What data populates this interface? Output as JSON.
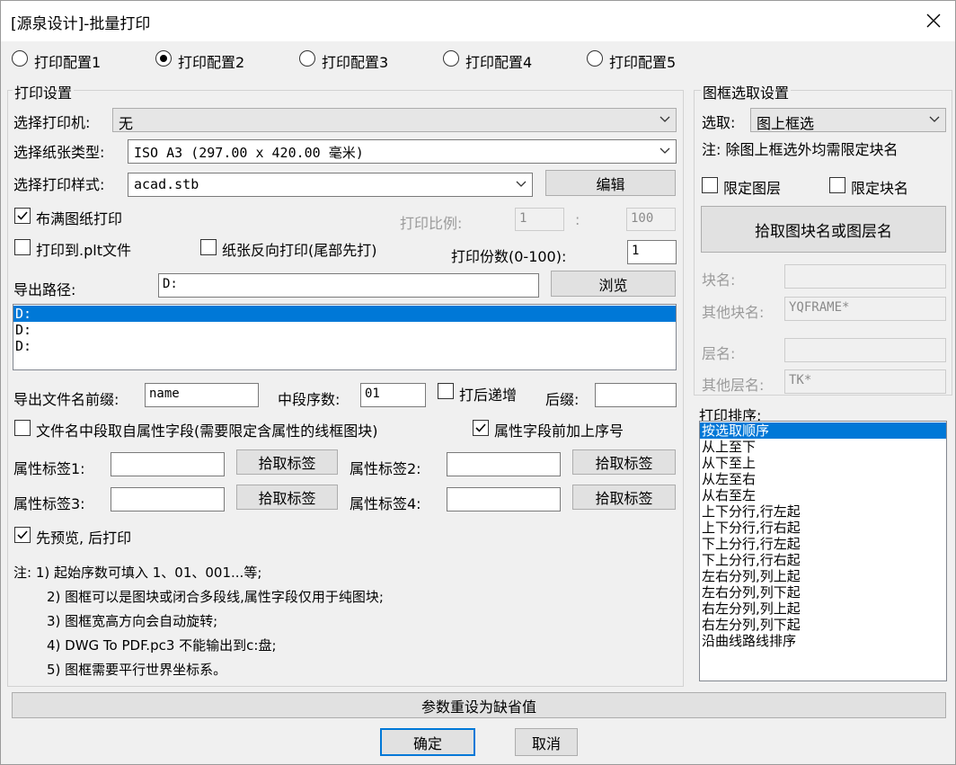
{
  "title": "[源泉设计]-批量打印",
  "config_tabs": [
    "打印配置1",
    "打印配置2",
    "打印配置3",
    "打印配置4",
    "打印配置5"
  ],
  "print_settings": {
    "group_label": "打印设置",
    "printer_label": "选择打印机:",
    "printer_value": "无",
    "paper_label": "选择纸张类型:",
    "paper_value": "ISO A3 (297.00 x 420.00 毫米)",
    "style_label": "选择打印样式:",
    "style_value": "acad.stb",
    "edit_button": "编辑",
    "fill_paper_label": "布满图纸打印",
    "scale_label": "打印比例:",
    "scale_left": "1",
    "scale_sep": ":",
    "scale_right": "100",
    "plot_file_label": "打印到.plt文件",
    "reverse_label": "纸张反向打印(尾部先打)",
    "copies_label": "打印份数(0-100):",
    "copies_value": "1",
    "export_path_label": "导出路径:",
    "export_path_value": "D:",
    "browse_button": "浏览",
    "path_list": [
      "D:",
      "D:",
      "D:"
    ],
    "prefix_label": "导出文件名前缀:",
    "prefix_value": "name",
    "mid_seq_label": "中段序数:",
    "mid_seq_value": "01",
    "increment_label": "打后递增",
    "suffix_label": "后缀:",
    "suffix_value": "",
    "attr_mid_label": "文件名中段取自属性字段(需要限定含属性的线框图块)",
    "attr_seq_label": "属性字段前加上序号",
    "attr_tags": [
      {
        "label": "属性标签1:",
        "value": "",
        "button": "拾取标签"
      },
      {
        "label": "属性标签2:",
        "value": "",
        "button": "拾取标签"
      },
      {
        "label": "属性标签3:",
        "value": "",
        "button": "拾取标签"
      },
      {
        "label": "属性标签4:",
        "value": "",
        "button": "拾取标签"
      }
    ],
    "preview_label": "先预览, 后打印",
    "notes": [
      "注: 1) 起始序数可填入 1、01、001...等;",
      "2) 图框可以是图块或闭合多段线,属性字段仅用于纯图块;",
      "3) 图框宽高方向会自动旋转;",
      "4) DWG To PDF.pc3 不能输出到c:盘;",
      "5) 图框需要平行世界坐标系。"
    ]
  },
  "frame_select": {
    "group_label": "图框选取设置",
    "select_label": "选取:",
    "select_value": "图上框选",
    "note": "注: 除图上框选外均需限定块名",
    "limit_layer_label": "限定图层",
    "limit_block_label": "限定块名",
    "pick_button": "拾取图块名或图层名",
    "block_name_label": "块名:",
    "block_name_value": "",
    "other_block_label": "其他块名:",
    "other_block_value": "YQFRAME*",
    "layer_name_label": "层名:",
    "layer_name_value": "",
    "other_layer_label": "其他层名:",
    "other_layer_value": "TK*"
  },
  "sort": {
    "label": "打印排序:",
    "items": [
      "按选取顺序",
      "从上至下",
      "从下至上",
      "从左至右",
      "从右至左",
      "上下分行,行左起",
      "上下分行,行右起",
      "下上分行,行左起",
      "下上分行,行右起",
      "左右分列,列上起",
      "左右分列,列下起",
      "右左分列,列上起",
      "右左分列,列下起",
      "沿曲线路线排序"
    ]
  },
  "reset_button": "参数重设为缺省值",
  "ok_button": "确定",
  "cancel_button": "取消",
  "colors": {
    "selection": "#0078d7",
    "focus_border": "#0078d7",
    "background": "#f0f0f0"
  }
}
